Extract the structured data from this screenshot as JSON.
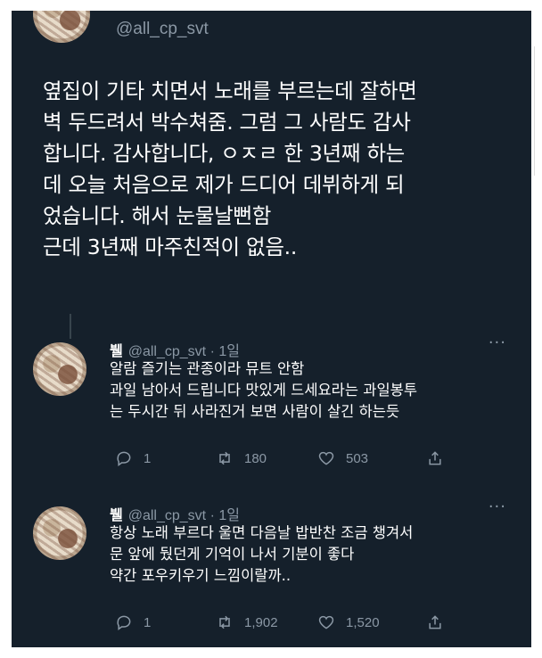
{
  "header": {
    "handle": "@all_cp_svt"
  },
  "tweet": {
    "lines": [
      "옆집이 기타 치면서 노래를 부르는데 잘하면",
      "벽 두드려서 박수쳐줌. 그럼 그 사람도 감사",
      "합니다. 감사합니다, ㅇㅈㄹ 한 3년째 하는",
      "데 오늘 처음으로 제가 드디어 데뷔하게 되",
      "었습니다. 해서 눈물날뻔함",
      "근데 3년째 마주친적이 없음.."
    ]
  },
  "replies": [
    {
      "name": "뷀",
      "handle_time": "@all_cp_svt · 1일",
      "more": "···",
      "lines": [
        "알람 즐기는 관종이라 뮤트 안함",
        "과일 남아서 드립니다 맛있게 드세요라는 과일봉투",
        "는 두시간 뒤 사라진거 보면 사람이 살긴 하는듯"
      ],
      "replies": "1",
      "retweets": "180",
      "likes": "503"
    },
    {
      "name": "뷀",
      "handle_time": "@all_cp_svt · 1일",
      "more": "···",
      "lines": [
        "항상 노래 부르다 울면 다음날 밥반찬 조금 챙겨서",
        "문 앞에 뒀던게 기억이 나서 기분이 좋다",
        "약간 포우키우기 느낌이랄까.."
      ],
      "replies": "1",
      "retweets": "1,902",
      "likes": "1,520"
    }
  ]
}
